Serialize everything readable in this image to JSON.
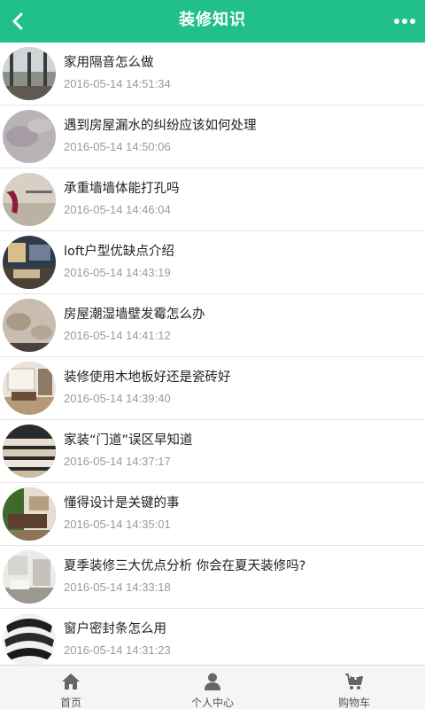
{
  "header": {
    "title": "装修知识"
  },
  "articles": [
    {
      "title": "家用隔音怎么做",
      "date": "2016-05-14 14:51:34"
    },
    {
      "title": "遇到房屋漏水的纠纷应该如何处理",
      "date": "2016-05-14 14:50:06"
    },
    {
      "title": "承重墙墙体能打孔吗",
      "date": "2016-05-14 14:46:04"
    },
    {
      "title": "loft户型优缺点介绍",
      "date": "2016-05-14 14:43:19"
    },
    {
      "title": "房屋潮湿墙壁发霉怎么办",
      "date": "2016-05-14 14:41:12"
    },
    {
      "title": "装修使用木地板好还是瓷砖好",
      "date": "2016-05-14 14:39:40"
    },
    {
      "title": "家装“门道”误区早知道",
      "date": "2016-05-14 14:37:17"
    },
    {
      "title": "懂得设计是关键的事",
      "date": "2016-05-14 14:35:01"
    },
    {
      "title": "夏季装修三大优点分析 你会在夏天装修吗?",
      "date": "2016-05-14 14:33:18"
    },
    {
      "title": "窗户密封条怎么用",
      "date": "2016-05-14 14:31:23"
    }
  ],
  "tabbar": {
    "home": "首页",
    "user_center": "个人中心",
    "cart": "购物车"
  },
  "colors": {
    "accent": "#21c08a",
    "tab_icon": "#666666"
  }
}
